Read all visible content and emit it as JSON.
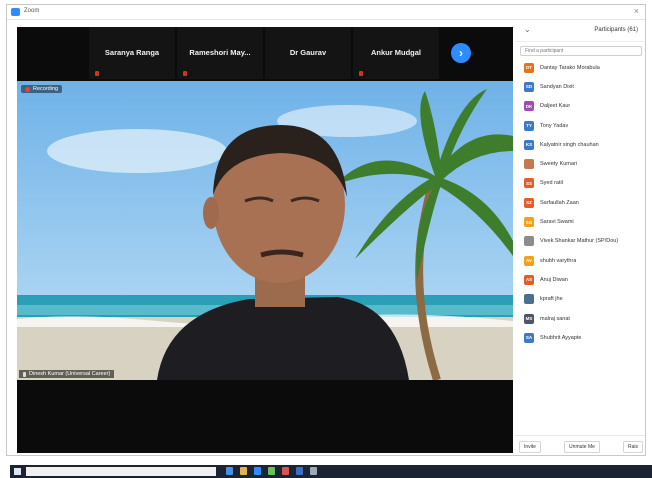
{
  "window": {
    "title": "Zoom",
    "close_glyph": "×"
  },
  "video_strip": {
    "thumbnails": [
      {
        "name": "Saranya Ranga"
      },
      {
        "name": "Rameshori  May..."
      },
      {
        "name": "Dr Gaurav"
      },
      {
        "name": "Ankur Mudgal"
      }
    ],
    "next_glyph": "›"
  },
  "main_video": {
    "recording_label": "Recording",
    "speaker_label": "Dinesh Kumar (Universal Career)"
  },
  "participants": {
    "collapse_glyph": "⌄",
    "title": "Participants (61)",
    "search_placeholder": "Find a participant",
    "list": [
      {
        "initials": "DT",
        "name": "Dantay Tarako Morabula",
        "color": "#e8711c",
        "photo": false
      },
      {
        "initials": "SD",
        "name": "Sandyan Dixit",
        "color": "#3c7ac8",
        "photo": false
      },
      {
        "initials": "DK",
        "name": "Daljeet Kaur",
        "color": "#a44cb6",
        "photo": false
      },
      {
        "initials": "TY",
        "name": "Tony Yadav",
        "color": "#3c7ac8",
        "photo": false
      },
      {
        "initials": "KS",
        "name": "Kalyatnir singh chauhan",
        "color": "#3c7ac8",
        "photo": false
      },
      {
        "initials": "",
        "name": "Sweety Kumari",
        "color": "#c6794a",
        "photo": true
      },
      {
        "initials": "SS",
        "name": "Syed ratil",
        "color": "#e35d27",
        "photo": false
      },
      {
        "initials": "SZ",
        "name": "Sarfaullah Zaan",
        "color": "#e35d27",
        "photo": false
      },
      {
        "initials": "SG",
        "name": "Saravi Swami",
        "color": "#f0a21a",
        "photo": false
      },
      {
        "initials": "",
        "name": "Vivek Shankar Mathur (SP/Dou)",
        "color": "#8c8c8c",
        "photo": true
      },
      {
        "initials": "AV",
        "name": "shubh varythra",
        "color": "#f0a21a",
        "photo": false
      },
      {
        "initials": "AS",
        "name": "Anuj Diwan",
        "color": "#e35d27",
        "photo": false
      },
      {
        "initials": "",
        "name": "kpraft jhe",
        "color": "#4a6f91",
        "photo": true
      },
      {
        "initials": "MS",
        "name": "malraj sanat",
        "color": "#4e5666",
        "photo": false
      },
      {
        "initials": "SA",
        "name": "Shubhrit Ayyapte",
        "color": "#3c7ac8",
        "photo": false
      }
    ],
    "footer": {
      "invite": "Invite",
      "unmute": "Unmute Me",
      "raise": "Rais"
    }
  },
  "colors": {
    "zoom_blue": "#2d8cff",
    "meeting_bg": "#0b0b0b",
    "taskbar": "#1c2434"
  },
  "icons": {
    "app": "zoom-app-icon",
    "next": "chevron-right-icon",
    "mic_off": "microphone-muted-icon",
    "rec": "recording-dot-icon",
    "start": "windows-start-icon"
  }
}
